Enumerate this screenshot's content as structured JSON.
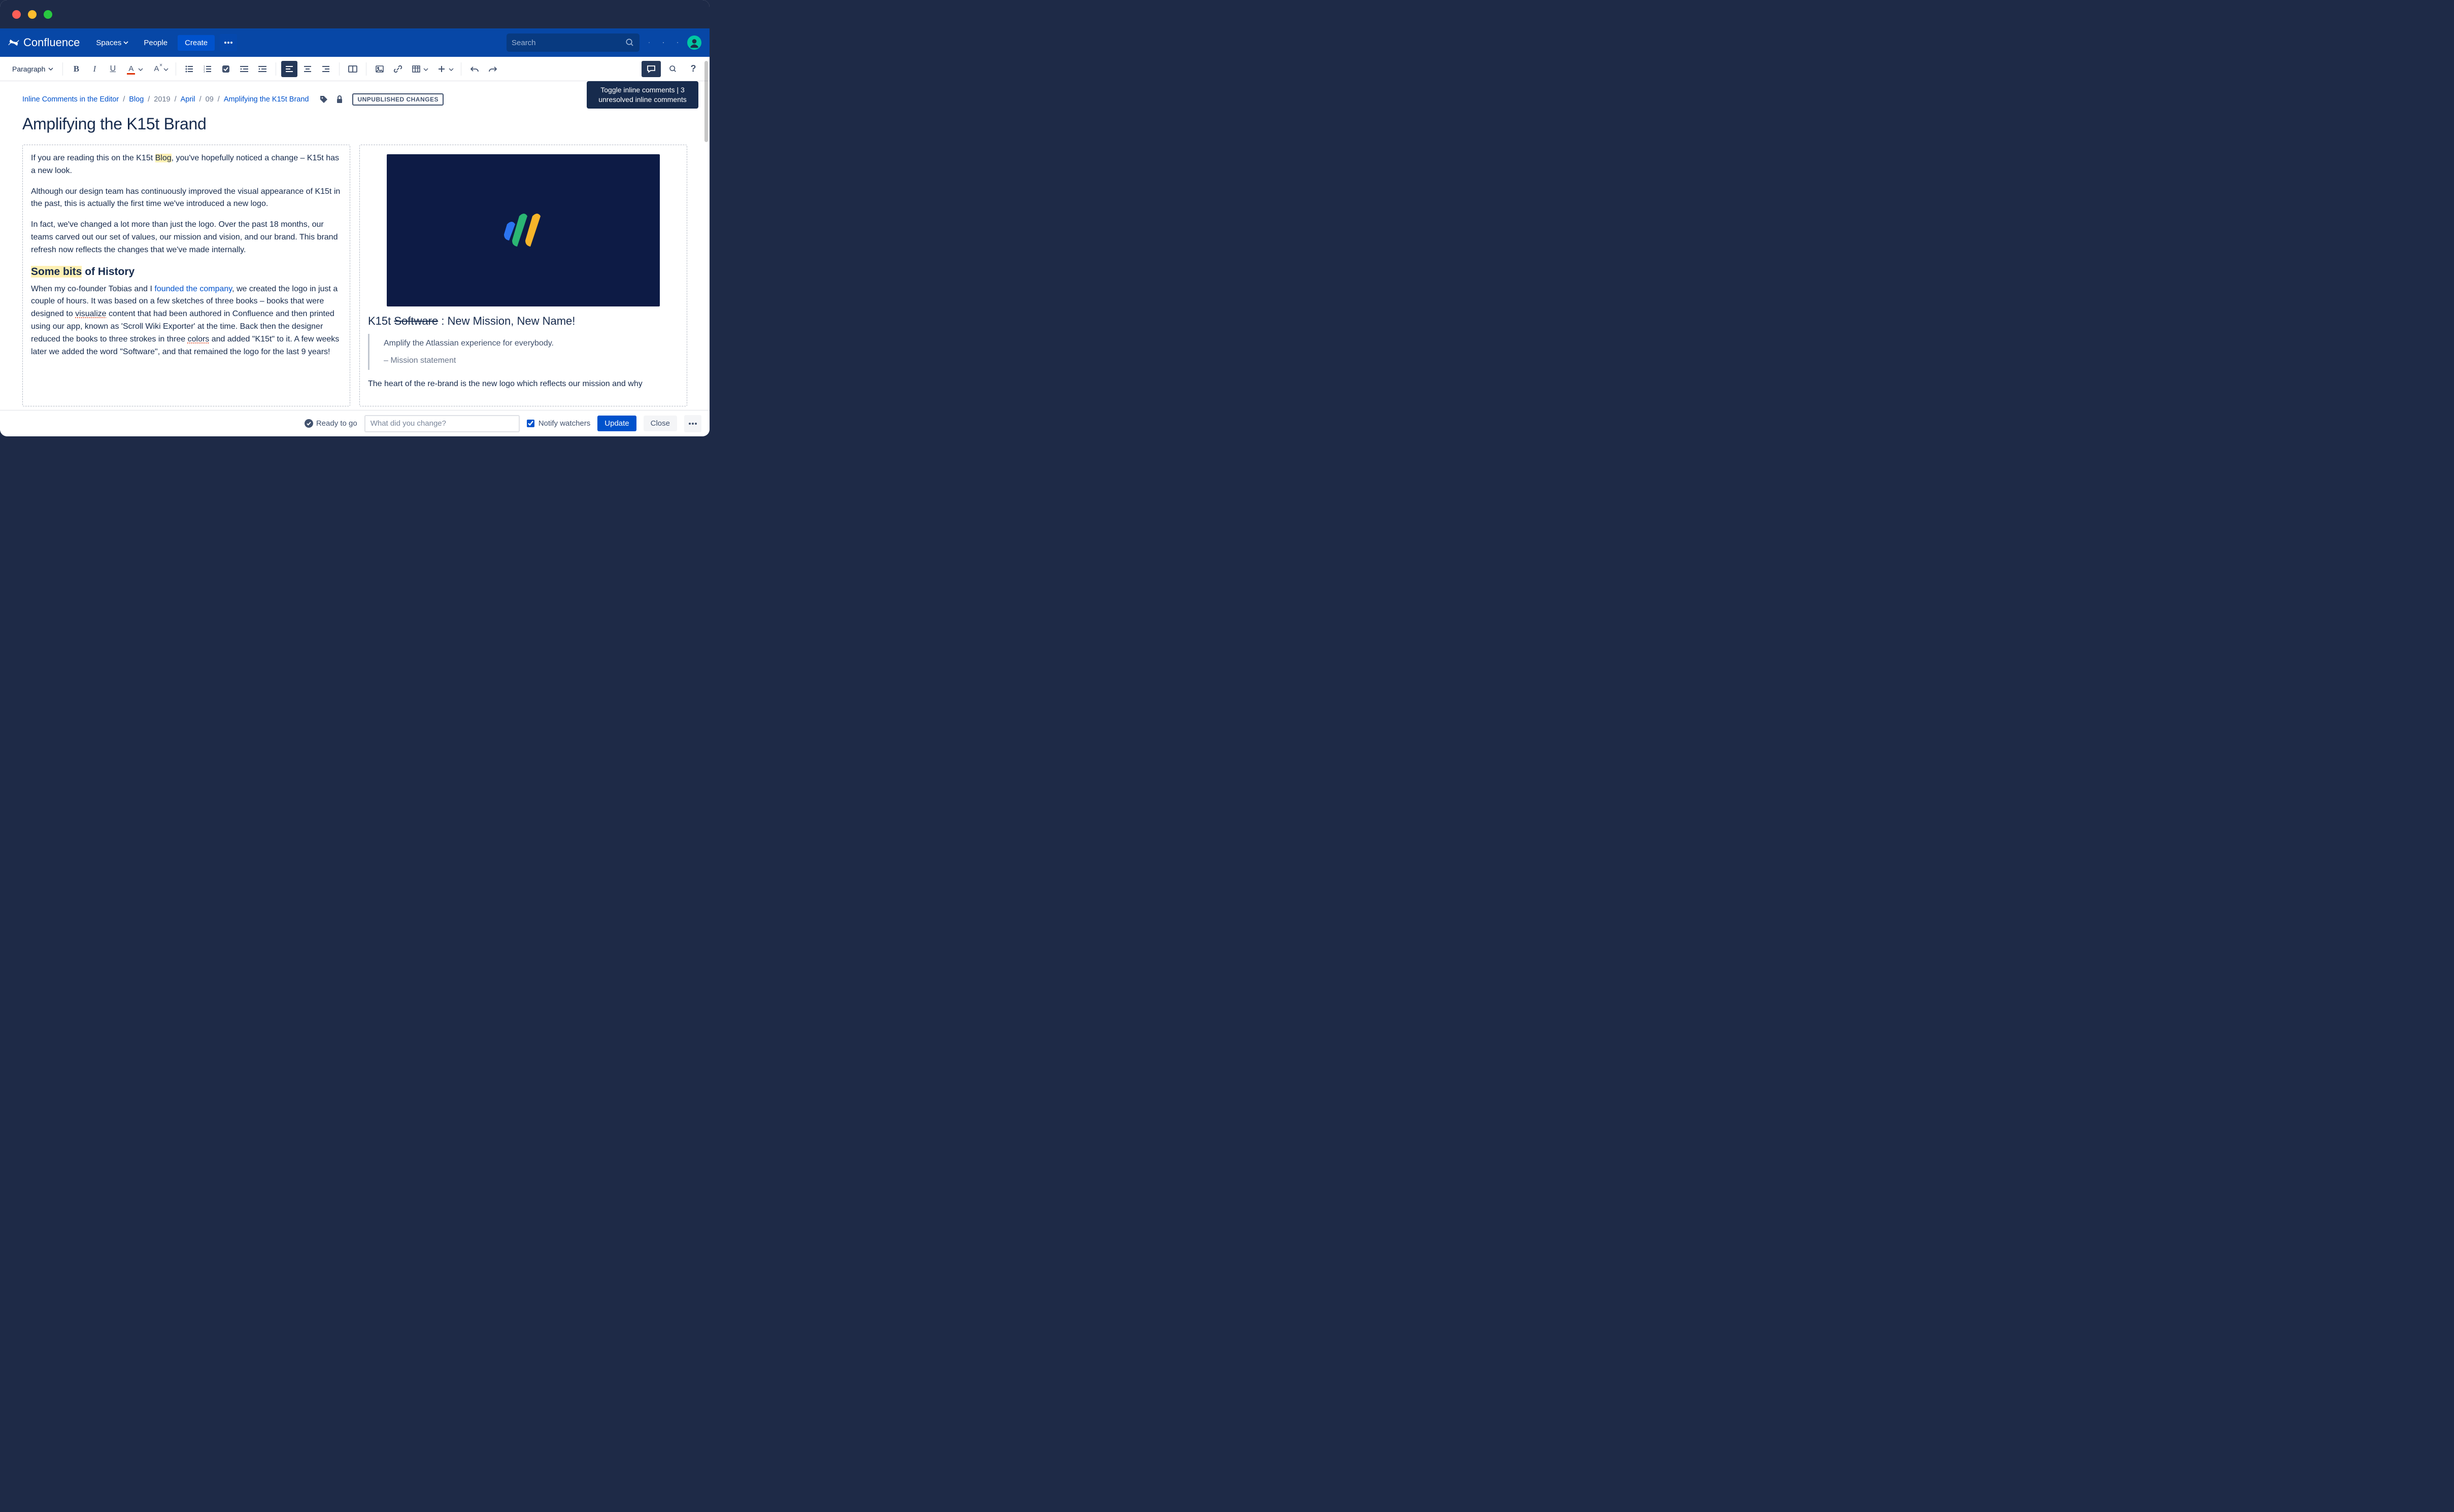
{
  "app": {
    "name": "Confluence",
    "nav": {
      "spaces": "Spaces",
      "people": "People",
      "create": "Create"
    },
    "search_placeholder": "Search"
  },
  "toolbar": {
    "style_select": "Paragraph"
  },
  "tooltip": {
    "text": "Toggle inline comments | 3 unresolved inline comments"
  },
  "breadcrumbs": {
    "root": "Inline Comments in the Editor",
    "items": [
      "Blog",
      "2019",
      "April",
      "09",
      "Amplifying the K15t Brand"
    ],
    "badge": "UNPUBLISHED CHANGES"
  },
  "page": {
    "title": "Amplifying the K15t Brand"
  },
  "left": {
    "p1_a": "If you are reading this on the K15t ",
    "p1_hl": "Blog",
    "p1_b": ", you've hopefully noticed a change – K15t has a new look.",
    "p2": "Although our design team has continuously improved the visual appearance of K15t in the past, this is actually the first time we've introduced a new logo.",
    "p3": "In fact, we've changed a lot more than just the logo. Over the past 18 months, our teams carved out our set of values, our mission and vision, and our brand. This brand refresh now reflects the changes that we've made internally.",
    "h2_hl": "Some bits",
    "h2_rest": " of History",
    "p4_a": "When my co-founder Tobias and I ",
    "p4_link": "founded the company",
    "p4_b": ", we created the logo in just a couple of hours. It was based on a few sketches of three books – books that were designed to ",
    "p4_spell1": "visualize",
    "p4_c": " content that had been authored in Confluence and then printed using our app, known as 'Scroll Wiki Exporter' at the time. Back then the designer reduced the books to three strokes in three ",
    "p4_spell2": "colors",
    "p4_d": " and added \"K15t\" to it. A few weeks later we added the word \"Software\", and that remained the logo for the last 9 years!"
  },
  "right": {
    "sub_a": "K15t ",
    "sub_strike": "Software",
    "sub_b": " : New Mission, New Name!",
    "quote": "Amplify the Atlassian experience for everybody.",
    "quote_author": "– Mission statement",
    "p1": "The heart of the re-brand is the new logo which reflects our mission and why"
  },
  "footer": {
    "ready": "Ready to go",
    "change_placeholder": "What did you change?",
    "notify": "Notify watchers",
    "update": "Update",
    "close": "Close"
  }
}
